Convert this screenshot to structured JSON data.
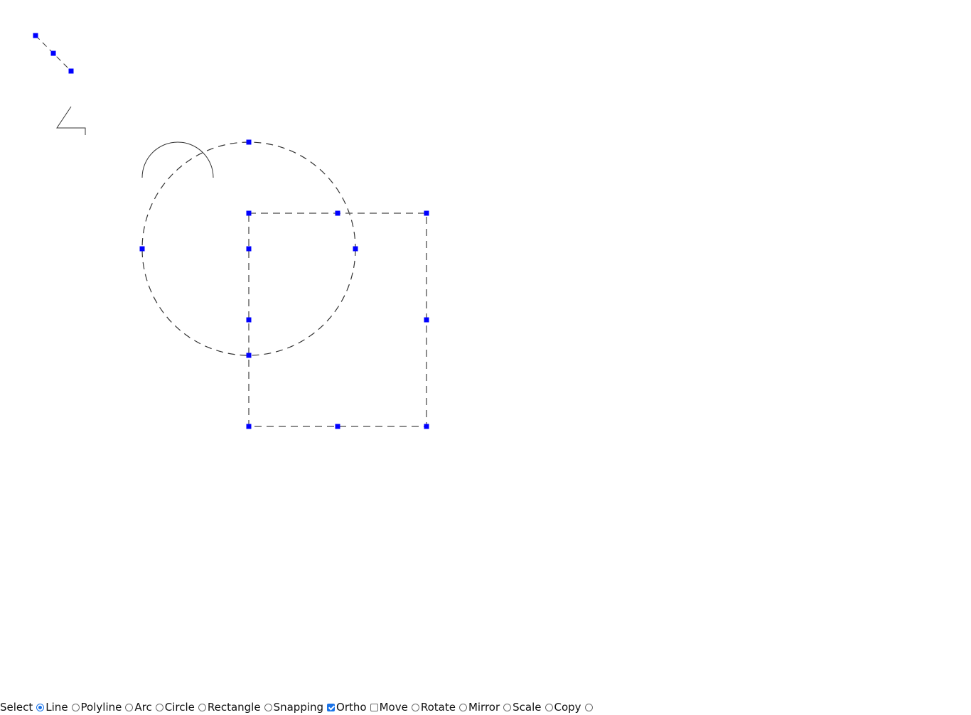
{
  "toolbar": {
    "items": [
      {
        "label": "Select",
        "control": "radio",
        "checked": true
      },
      {
        "label": "Line",
        "control": "radio",
        "checked": false
      },
      {
        "label": "Polyline",
        "control": "radio",
        "checked": false
      },
      {
        "label": "Arc",
        "control": "radio",
        "checked": false
      },
      {
        "label": "Circle",
        "control": "radio",
        "checked": false
      },
      {
        "label": "Rectangle",
        "control": "radio",
        "checked": false
      },
      {
        "label": "Snapping",
        "control": "checkbox",
        "checked": true
      },
      {
        "label": "Ortho",
        "control": "checkbox",
        "checked": false
      },
      {
        "label": "Move",
        "control": "radio",
        "checked": false
      },
      {
        "label": "Rotate",
        "control": "radio",
        "checked": false
      },
      {
        "label": "Mirror",
        "control": "radio",
        "checked": false
      },
      {
        "label": "Scale",
        "control": "radio",
        "checked": false
      },
      {
        "label": "Copy",
        "control": "radio",
        "checked": false
      }
    ]
  },
  "colors": {
    "grip": "#0000ff",
    "shape_stroke": "#333333",
    "selected_stroke": "#555555",
    "accent": "#1a73e8"
  }
}
